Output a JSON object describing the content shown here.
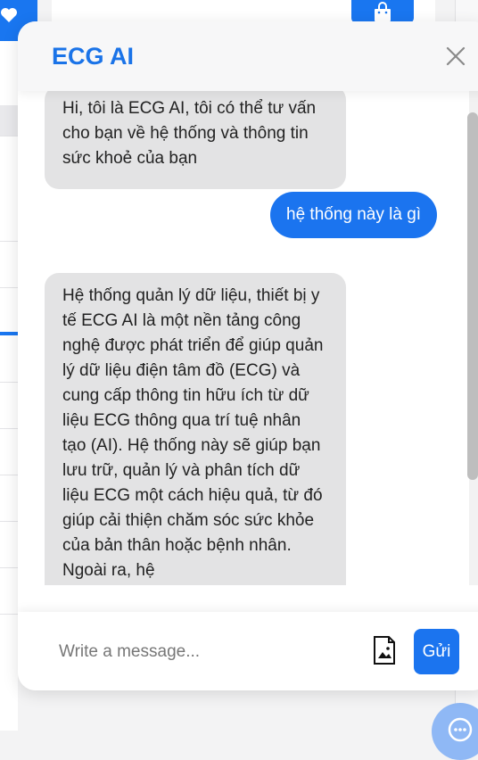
{
  "chat": {
    "title": "ECG AI",
    "messages": [
      {
        "role": "bot",
        "text": "Hi, tôi là ECG AI, tôi có thể tư vấn cho bạn về hệ thống và thông tin sức khoẻ của bạn"
      },
      {
        "role": "user",
        "text": "hệ thống này là gì"
      },
      {
        "role": "bot",
        "text": "Hệ thống quản lý dữ liệu, thiết bị y tế ECG AI là một nền tảng công nghệ được phát triển để giúp quản lý dữ liệu điện tâm đồ (ECG) và cung cấp thông tin hữu ích từ dữ liệu ECG thông qua trí tuệ nhân tạo (AI). Hệ thống này sẽ giúp bạn lưu trữ, quản lý và phân tích dữ liệu ECG một cách hiệu quả, từ đó giúp cải thiện chăm sóc sức khỏe của bản thân hoặc bệnh nhân. Ngoài ra, hệ"
      }
    ],
    "composer": {
      "placeholder": "Write a message...",
      "send_label": "Gửi"
    }
  },
  "icons": [
    "close-icon",
    "image-upload-icon",
    "heart-icon",
    "shopping-bag-icon",
    "chat-fab-icon"
  ],
  "colors": {
    "accent": "#1b74ef",
    "bot_bubble": "#e3e3e4"
  }
}
